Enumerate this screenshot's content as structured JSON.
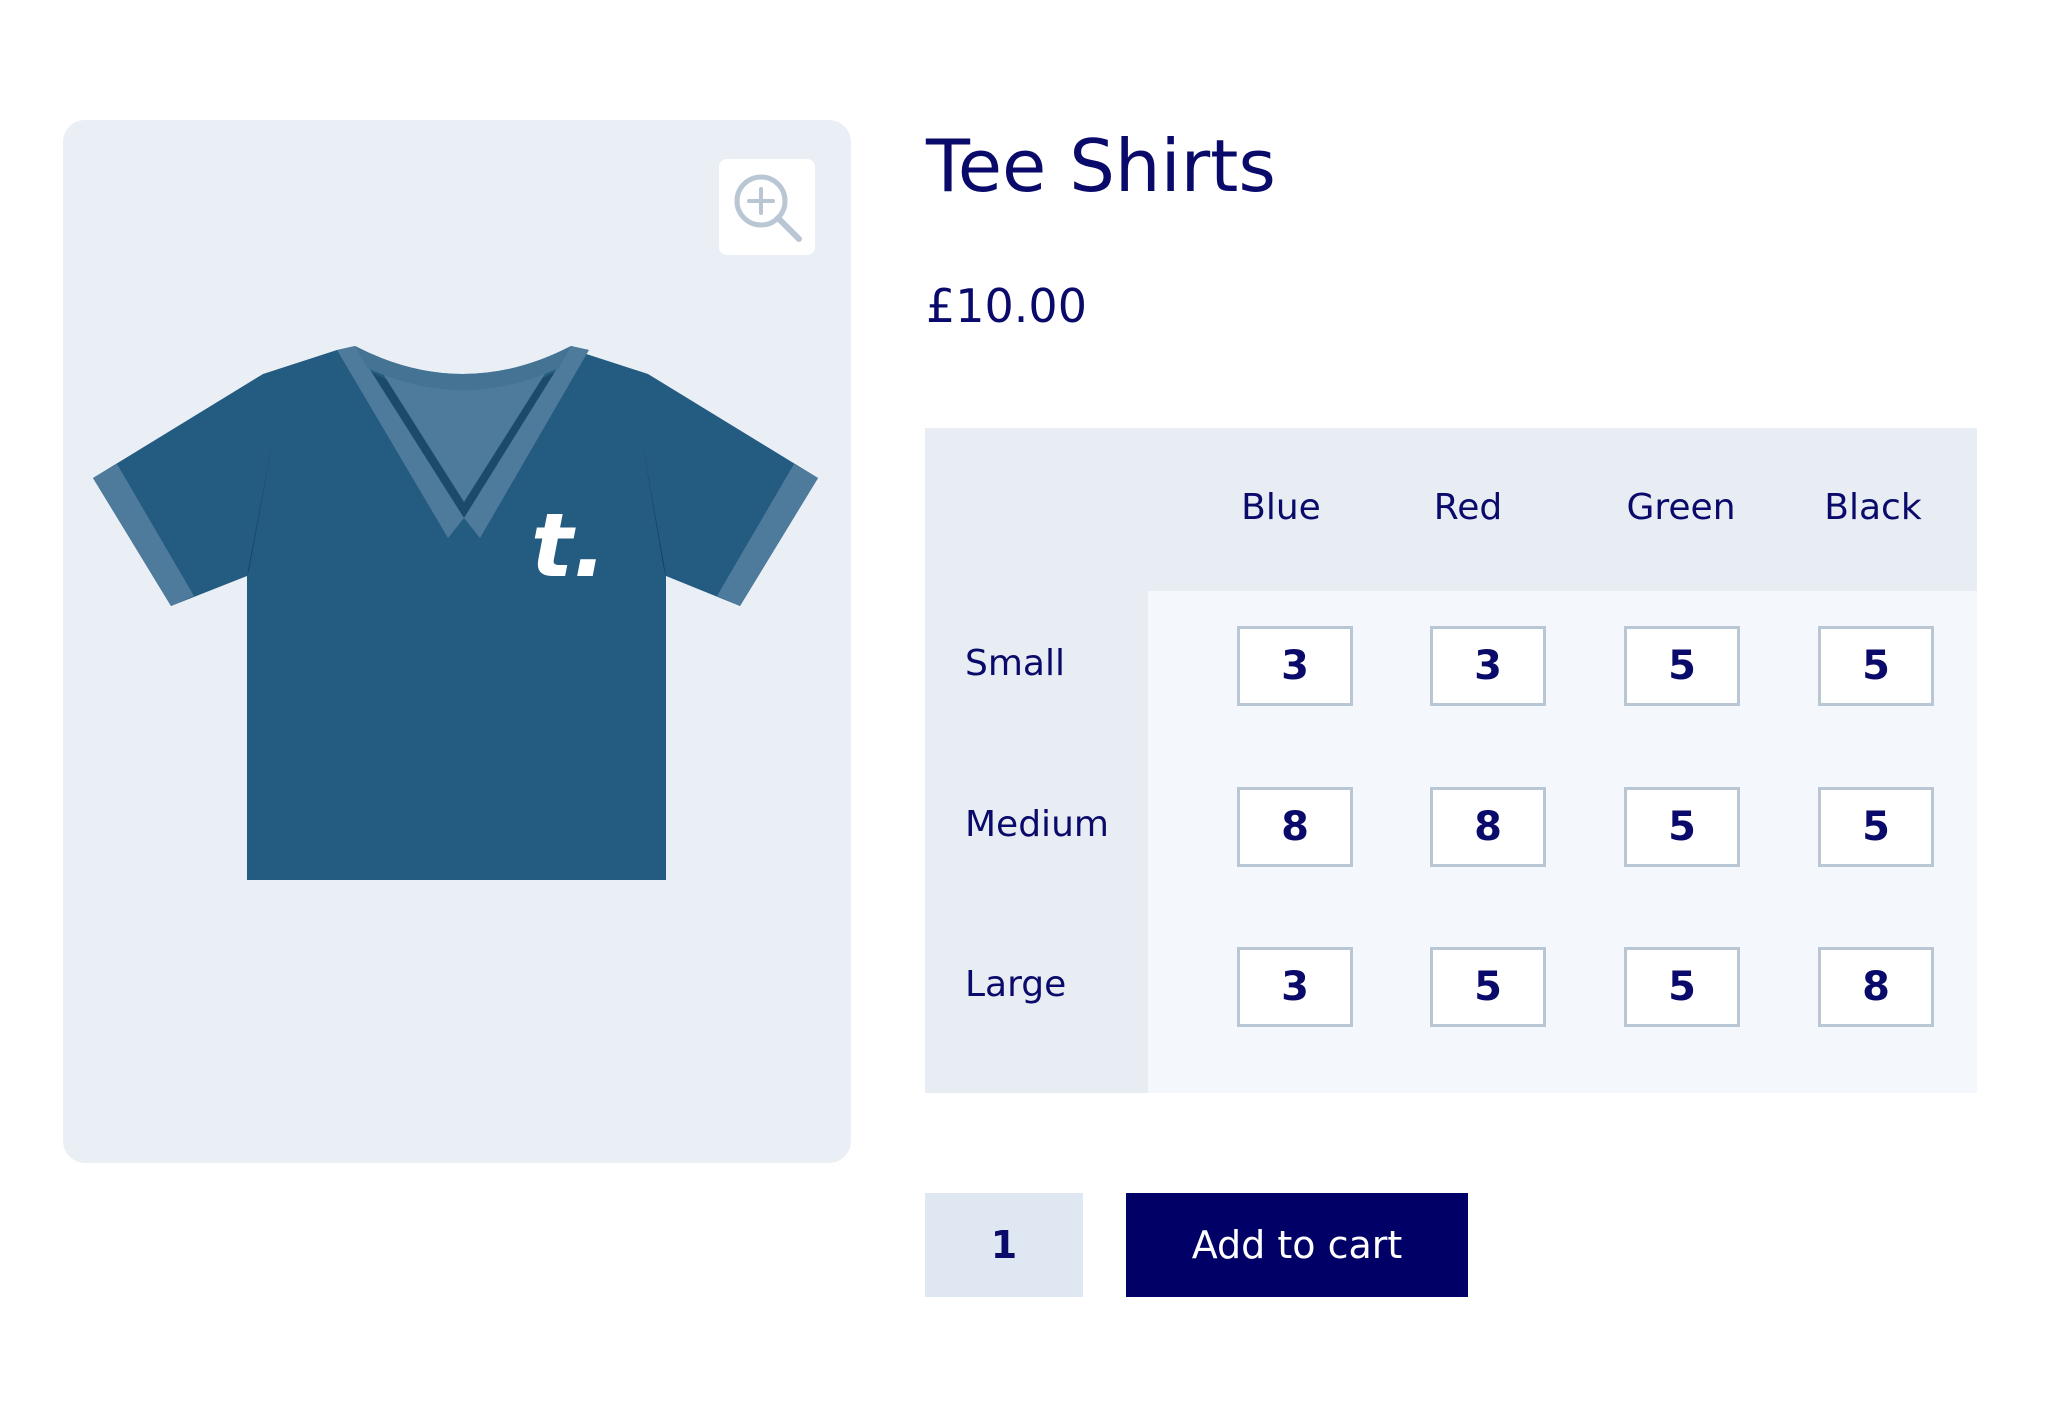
{
  "product": {
    "title": "Tee Shirts",
    "price": "£10.00",
    "image_alt": "tshirt-illustration",
    "logo_text": "t."
  },
  "zoom": {
    "icon": "zoom-in-icon"
  },
  "grid": {
    "columns": [
      "Blue",
      "Red",
      "Green",
      "Black"
    ],
    "rows": [
      {
        "label": "Small",
        "values": [
          "3",
          "3",
          "5",
          "5"
        ]
      },
      {
        "label": "Medium",
        "values": [
          "8",
          "8",
          "5",
          "5"
        ]
      },
      {
        "label": "Large",
        "values": [
          "3",
          "5",
          "5",
          "8"
        ]
      }
    ]
  },
  "cart": {
    "quantity": "1",
    "button_label": "Add to cart"
  },
  "colors": {
    "accent": "#000066",
    "text": "#0a0a6b",
    "tshirt": "#245b80",
    "tshirt_trim": "#4e7b9c",
    "panel": "#eaeff6"
  }
}
